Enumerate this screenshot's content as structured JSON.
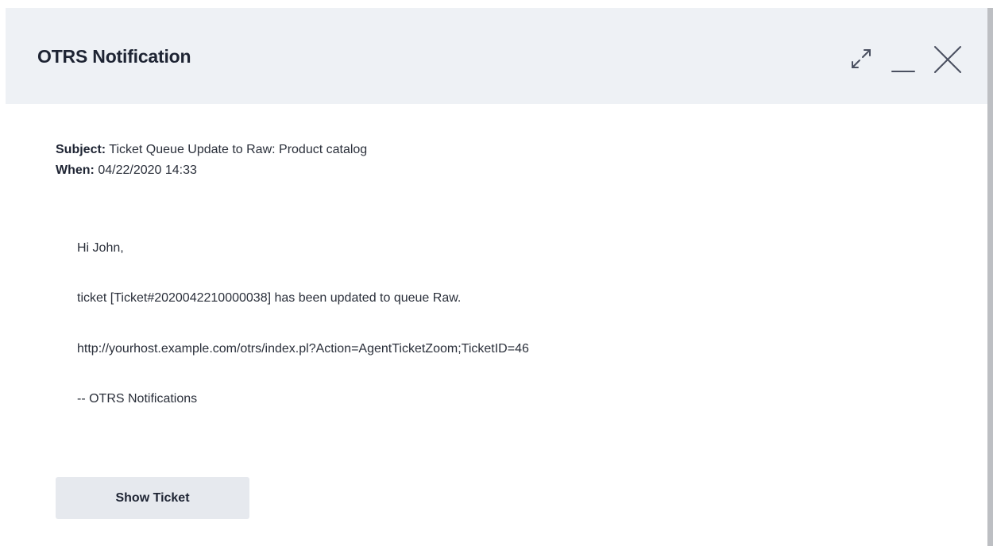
{
  "dialog": {
    "title": "OTRS Notification",
    "controls": {
      "expand_icon": "expand-icon",
      "minimize_icon": "minimize-icon",
      "close_icon": "close-icon"
    }
  },
  "meta": {
    "subject_label": "Subject:",
    "subject_value": "Ticket Queue Update to Raw: Product catalog",
    "when_label": "When:",
    "when_value": "04/22/2020 14:33"
  },
  "message": {
    "greeting": "Hi John,",
    "line1": "ticket [Ticket#2020042210000038] has been updated to queue Raw.",
    "link": "http://yourhost.example.com/otrs/index.pl?Action=AgentTicketZoom;TicketID=46",
    "signature": "-- OTRS Notifications"
  },
  "actions": {
    "show_ticket_label": "Show Ticket"
  },
  "colors": {
    "header_bg": "#eef1f5",
    "button_bg": "#e6e9ee",
    "text": "#1e2433"
  }
}
